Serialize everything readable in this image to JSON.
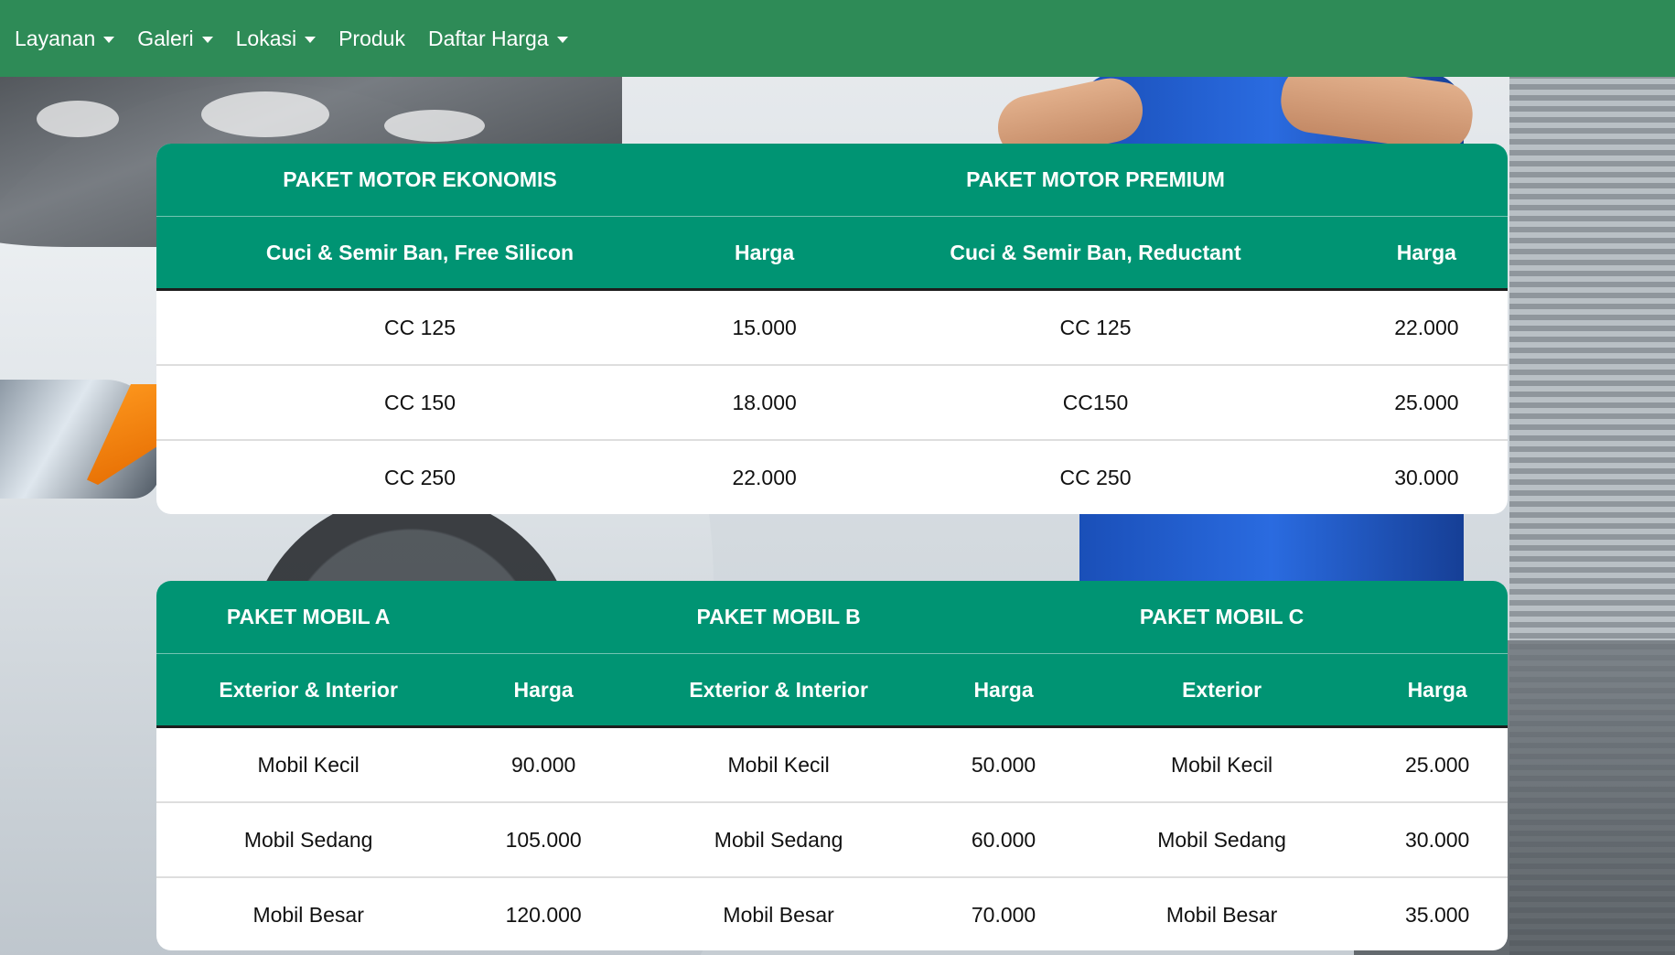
{
  "navbar": {
    "items": [
      {
        "label": "Layanan",
        "dropdown": true
      },
      {
        "label": "Galeri",
        "dropdown": true
      },
      {
        "label": "Lokasi",
        "dropdown": true
      },
      {
        "label": "Produk",
        "dropdown": false
      },
      {
        "label": "Daftar Harga",
        "dropdown": true
      }
    ],
    "color": "#2e8b57"
  },
  "theme": {
    "table_header_color": "#009473"
  },
  "motor": {
    "groups": [
      "PAKET MOTOR EKONOMIS",
      "PAKET MOTOR PREMIUM"
    ],
    "headers": [
      "Cuci & Semir Ban, Free Silicon",
      "Harga",
      "Cuci & Semir Ban, Reductant",
      "Harga"
    ],
    "rows": [
      [
        "CC 125",
        "15.000",
        "CC 125",
        "22.000"
      ],
      [
        "CC 150",
        "18.000",
        "CC150",
        "25.000"
      ],
      [
        "CC 250",
        "22.000",
        "CC 250",
        "30.000"
      ]
    ]
  },
  "mobil": {
    "groups": [
      "PAKET MOBIL A",
      "PAKET MOBIL B",
      "PAKET MOBIL C"
    ],
    "headers": [
      "Exterior & Interior",
      "Harga",
      "Exterior & Interior",
      "Harga",
      "Exterior",
      "Harga"
    ],
    "rows": [
      [
        "Mobil Kecil",
        "90.000",
        "Mobil Kecil",
        "50.000",
        "Mobil Kecil",
        "25.000"
      ],
      [
        "Mobil Sedang",
        "105.000",
        "Mobil Sedang",
        "60.000",
        "Mobil Sedang",
        "30.000"
      ],
      [
        "Mobil Besar",
        "120.000",
        "Mobil Besar",
        "70.000",
        "Mobil Besar",
        "35.000"
      ]
    ]
  }
}
